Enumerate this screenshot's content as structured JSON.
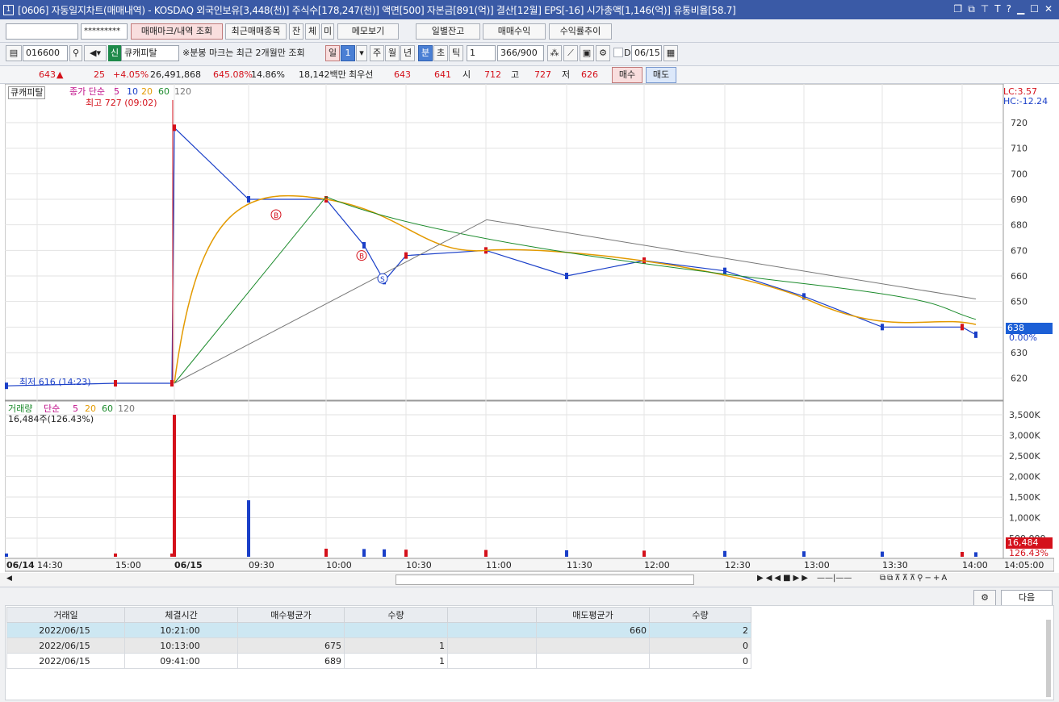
{
  "window": {
    "number": "1",
    "title": "[0606] 자동일지차트(매매내역) - KOSDAQ 외국인보유[3,448(천)] 주식수[178,247(천)] 액면[500] 자본금[891(억)] 결산[12월] EPS[-16] 시가총액[1,146(억)] 유통비율[58.7]",
    "icons": [
      "restore-icon",
      "copy-icon",
      "pin-icon",
      "text-icon",
      "help-icon",
      "minimize-icon",
      "maximize-icon",
      "close-icon"
    ]
  },
  "toolbar1": {
    "account_value": "",
    "password_value": "*********",
    "btn_marks": "매매마크/내역 조회",
    "btn_recent": "최근매매종목",
    "btn_jan": "잔",
    "btn_che": "체",
    "btn_mi": "미",
    "btn_memo": "메모보기",
    "btn_daily": "일별잔고",
    "btn_profit": "매매수익",
    "btn_trend": "수익률추이"
  },
  "toolbar2": {
    "code": "016600",
    "badge": "신",
    "name": "큐캐피탈",
    "notice": "※분봉 마크는 최근 2개월만 조회",
    "period_il": "일",
    "period_num": "1",
    "period_ju": "주",
    "period_wol": "월",
    "period_nyeon": "년",
    "period_bun": "분",
    "period_cho": "초",
    "period_tick": "틱",
    "interval": "1",
    "count": "366/900",
    "date": "06/15",
    "date_check": "D"
  },
  "quote": {
    "price": "643",
    "arrow": "▲",
    "change": "25",
    "change_pct": "+4.05%",
    "volume": "26,491,868",
    "volume_pct": "645.08%",
    "turnover": "14.86%",
    "amount": "18,142백만",
    "best_label": "최우선",
    "best_ask": "643",
    "best_bid": "641",
    "open_label": "시",
    "open": "712",
    "high_label": "고",
    "high": "727",
    "low_label": "저",
    "low": "626",
    "buy_btn": "매수",
    "sell_btn": "매도"
  },
  "chart": {
    "legend_name": "큐캐피탈",
    "ma_label": "종가 단순",
    "ma5": "5",
    "ma10": "10",
    "ma20": "20",
    "ma60": "60",
    "ma120": "120",
    "high_note": "최고 727 (09:02)",
    "low_note": "최저 616 (14:23)",
    "lc": "LC:3.57",
    "hc": "HC:-12.24",
    "price_tag": "638",
    "pct_tag": "0.00%",
    "price_axis": [
      "720",
      "710",
      "700",
      "690",
      "680",
      "670",
      "660",
      "650",
      "640",
      "630",
      "620"
    ],
    "vol_label": "거래량",
    "vol_ma_label": "단순",
    "vol_ma5": "5",
    "vol_ma20": "20",
    "vol_ma60": "60",
    "vol_ma120": "120",
    "vol_note": "16,484주(126.43%)",
    "vol_axis": [
      "3,500K",
      "3,000K",
      "2,500K",
      "2,000K",
      "1,500K",
      "1,000K",
      "500,000"
    ],
    "vol_tag": "16,484",
    "vol_pct_tag": "126.43%",
    "time_axis": [
      "06/14",
      "14:30",
      "15:00",
      "06/15",
      "09:30",
      "10:00",
      "10:30",
      "11:00",
      "11:30",
      "12:00",
      "12:30",
      "13:00",
      "13:30",
      "14:00",
      "14:05:00"
    ],
    "marks": [
      "B",
      "B",
      "S"
    ]
  },
  "chart_data": {
    "type": "line",
    "title": "큐캐피탈",
    "ylim": [
      612,
      732
    ],
    "x": [
      "06/14 14:30",
      "06/14 15:00",
      "06/15 09:00",
      "09:02",
      "09:30",
      "10:00",
      "10:15",
      "10:20",
      "10:30",
      "11:00",
      "11:30",
      "12:00",
      "12:30",
      "13:00",
      "13:30",
      "14:00",
      "14:05"
    ],
    "series": [
      {
        "name": "종가",
        "values": [
          617,
          618,
          618,
          718,
          690,
          690,
          672,
          658,
          668,
          670,
          660,
          666,
          662,
          652,
          640,
          640,
          637
        ]
      }
    ]
  },
  "trades": {
    "headers": [
      "거래일",
      "체결시간",
      "매수평균가",
      "수량",
      "",
      "매도평균가",
      "수량"
    ],
    "rows": [
      [
        "2022/06/15",
        "10:21:00",
        "",
        "",
        "",
        "660",
        "2"
      ],
      [
        "2022/06/15",
        "10:13:00",
        "675",
        "1",
        "",
        "",
        "0"
      ],
      [
        "2022/06/15",
        "09:41:00",
        "689",
        "1",
        "",
        "",
        "0"
      ]
    ],
    "next_btn": "다음"
  }
}
